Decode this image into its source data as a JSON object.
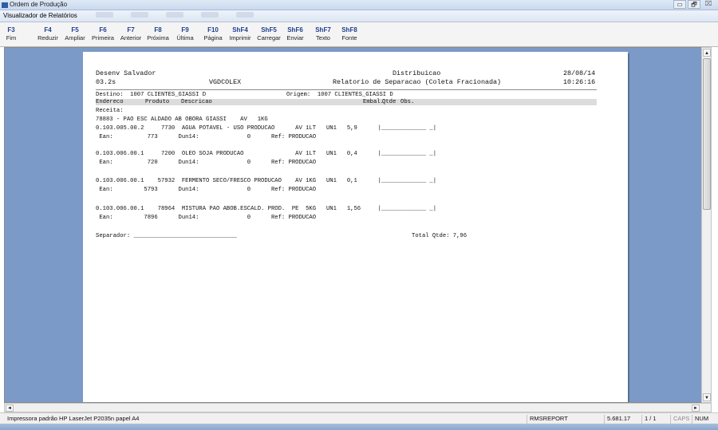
{
  "window": {
    "outer_title": "Ordem de Produção",
    "inner_title": "Visualizador de Relatórios",
    "controls": {
      "minimize": "▭",
      "maximize": "🗗",
      "close": "⌧"
    }
  },
  "toolbar": {
    "buttons": [
      {
        "key": "F3",
        "label": "Fim"
      },
      {
        "key": "F4",
        "label": "Reduzir"
      },
      {
        "key": "F5",
        "label": "Ampliar"
      },
      {
        "key": "F6",
        "label": "Primeira"
      },
      {
        "key": "F7",
        "label": "Anterior"
      },
      {
        "key": "F8",
        "label": "Próxima"
      },
      {
        "key": "F9",
        "label": "Última"
      },
      {
        "key": "F10",
        "label": "Página"
      },
      {
        "key": "ShF4",
        "label": "Imprimir"
      },
      {
        "key": "ShF5",
        "label": "Carregar"
      },
      {
        "key": "ShF6",
        "label": "Enviar"
      },
      {
        "key": "ShF7",
        "label": "Texto"
      },
      {
        "key": "ShF8",
        "label": "Fonte"
      }
    ]
  },
  "report": {
    "company": "Desenv Salvador",
    "branch": "03.2s",
    "program": "VGDCOLEX",
    "department": "Distribuicao",
    "title": "Relatorio de Separacao (Coleta Fracionada)",
    "date": "28/08/14",
    "time": "10:26:16",
    "destino": "Destino:  1007 CLIENTES_GIASSI D",
    "origem": "Origem:  1007 CLIENTES_GIASSI D",
    "columns": {
      "endereco": "Endereco",
      "produto": "Produto",
      "descricao": "Descricao",
      "embal": "Embal.",
      "qtde": "Qtde",
      "obs": "Obs."
    },
    "receita_label": "Receita:",
    "receita": "78883 - PAO ESC ALDADO AB OBORA GIASSI    AV   1KG",
    "items": [
      {
        "line": "0.103.005.00.2     7730  AGUA POTAVEL - USO PRODUCAO      AV 1LT   UN1   5,9      |_____________ _|",
        "ean": " Ean:          773      Dun14:              0      Ref: PRODUCAO"
      },
      {
        "line": "0.103.006.00.1     7200  OLEO SOJA PRODUCAO               AV 1LT   UN1   0,4      |_____________ _|",
        "ean": " Ean:          720      Dun14:              0      Ref: PRODUCAO"
      },
      {
        "line": "0.103.006.00.1    57932  FERMENTO SECO/FRESCO PRODUCAO    AV 1KG   UN1   0,1      |_____________ _|",
        "ean": " Ean:         5793      Dun14:              0      Ref: PRODUCAO"
      },
      {
        "line": "0.103.006.00.1    78964  MISTURA PAO ABOB.ESCALD. PROD.  PE  5KG   UN1   1,56     |_____________ _|",
        "ean": " Ean:         7896      Dun14:              0      Ref: PRODUCAO"
      }
    ],
    "separador": "Separador: ______________________________",
    "total": "Total Qtde: 7,96"
  },
  "scrollbar": {
    "up": "▲",
    "down": "▼",
    "left": "◄",
    "right": "►"
  },
  "statusbar": {
    "printer": "Impressora padrão HP LaserJet P2035n papel A4",
    "module": "RMSREPORT",
    "version": "5.681.17",
    "page": "1 / 1",
    "caps": "CAPS",
    "num": "NUM"
  }
}
